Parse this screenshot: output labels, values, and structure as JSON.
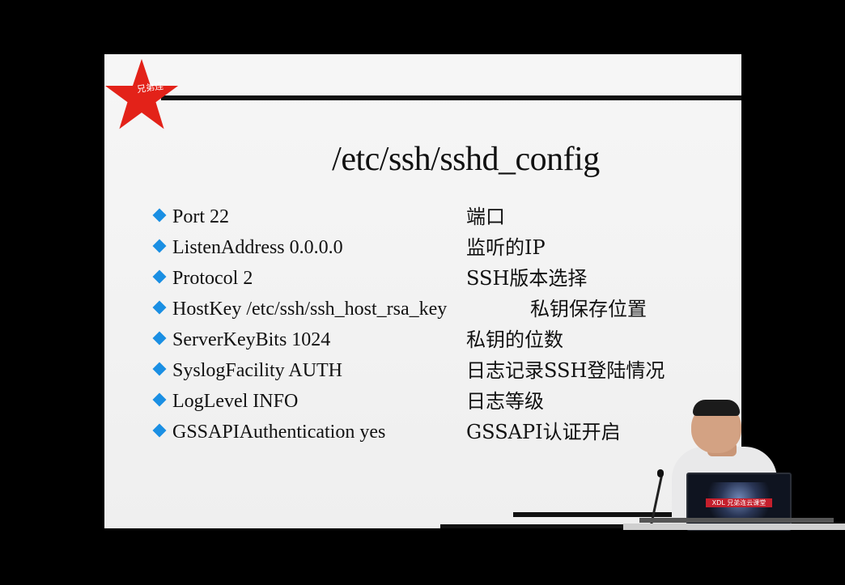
{
  "logo": {
    "text": "兄弟连",
    "star_color": "#e32219"
  },
  "slide": {
    "title": "/etc/ssh/sshd_config",
    "bullet_color": "#1a8fe3",
    "items": [
      {
        "key": "Port 22",
        "desc": "端口"
      },
      {
        "key": "ListenAddress 0.0.0.0",
        "desc": "监听的IP"
      },
      {
        "key": "Protocol 2",
        "desc": "SSH版本选择"
      },
      {
        "key": "HostKey /etc/ssh/ssh_host_rsa_key",
        "desc": "私钥保存位置"
      },
      {
        "key": "ServerKeyBits 1024",
        "desc": "私钥的位数"
      },
      {
        "key": "SyslogFacility AUTH",
        "desc": "日志记录SSH登陆情况"
      },
      {
        "key": "LogLevel INFO",
        "desc": "日志等级"
      },
      {
        "key": "GSSAPIAuthentication  yes",
        "desc": "GSSAPI认证开启"
      }
    ]
  },
  "laptop": {
    "badge": "XDL 兄弟连云课堂"
  }
}
